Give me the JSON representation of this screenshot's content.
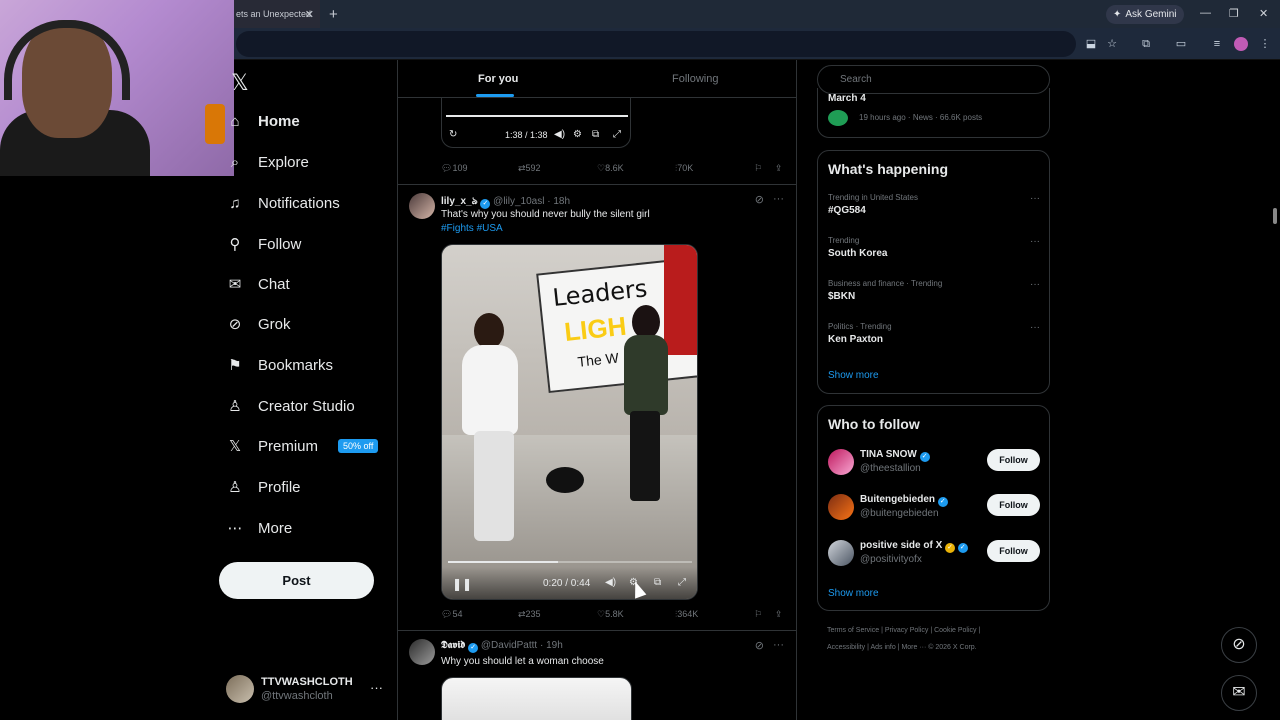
{
  "browser": {
    "tab_title": "ets an Unexpected",
    "new_tab": "+",
    "gemini_label": "Ask Gemini",
    "window_controls": [
      "—",
      "❐",
      "✕"
    ]
  },
  "sidebar": {
    "logo": "𝕏",
    "items": [
      {
        "label": "Home",
        "icon": "home-icon",
        "glyph": "⌂"
      },
      {
        "label": "Explore",
        "icon": "search-icon",
        "glyph": "⌕"
      },
      {
        "label": "Notifications",
        "icon": "bell-icon",
        "glyph": "🔔"
      },
      {
        "label": "Follow",
        "icon": "person-add-icon",
        "glyph": "👤"
      },
      {
        "label": "Chat",
        "icon": "mail-icon",
        "glyph": "✉"
      },
      {
        "label": "Grok",
        "icon": "grok-icon",
        "glyph": "⊘"
      },
      {
        "label": "Bookmarks",
        "icon": "bookmark-icon",
        "glyph": "🔖"
      },
      {
        "label": "Creator Studio",
        "icon": "creator-icon",
        "glyph": "♙"
      },
      {
        "label": "Premium",
        "icon": "x-premium-icon",
        "glyph": "𝕏"
      },
      {
        "label": "Profile",
        "icon": "profile-icon",
        "glyph": "👤"
      },
      {
        "label": "More",
        "icon": "more-circle-icon",
        "glyph": "⋯"
      }
    ],
    "premium_badge": "50% off",
    "post_label": "Post",
    "account": {
      "name": "TTVWASHCLOTH",
      "handle": "@ttvwashcloth",
      "menu": "···"
    }
  },
  "timeline": {
    "tabs": [
      "For you",
      "Following"
    ],
    "prev_video": {
      "time": "1:38 / 1:38"
    },
    "prev_actions": {
      "replies": "109",
      "reposts": "592",
      "likes": "8.6K",
      "views": "70K"
    },
    "tweet1": {
      "name": "lily_x_ঌ",
      "handle": "@lily_10asl",
      "time": "· 18h",
      "text": "That's why you should never bully the silent girl",
      "tags": "#Fights #USA",
      "video_time": "0:20 / 0:44",
      "video_progress": 0.45,
      "sign_line1": "Leaders",
      "sign_line2": "LIGH",
      "sign_line3": "The W",
      "actions": {
        "replies": "54",
        "reposts": "235",
        "likes": "5.8K",
        "views": "364K"
      }
    },
    "tweet2": {
      "name": "𝕯𝖆𝖛𝖎𝖉",
      "handle": "@DavidPattt",
      "time": "· 19h",
      "text": "Why you should let a woman choose"
    }
  },
  "right": {
    "search_placeholder": "Search",
    "live": {
      "title": "March 4",
      "meta": "19 hours ago · News · 66.6K posts"
    },
    "whats_happening": {
      "title": "What's happening",
      "trends": [
        {
          "context": "Trending in United States",
          "name": "#QG584"
        },
        {
          "context": "Trending",
          "name": "South Korea"
        },
        {
          "context": "Business and finance · Trending",
          "name": "$BKN"
        },
        {
          "context": "Politics · Trending",
          "name": "Ken Paxton"
        }
      ],
      "show_more": "Show more"
    },
    "who_to_follow": {
      "title": "Who to follow",
      "accounts": [
        {
          "name": "TINA SNOW",
          "handle": "@theestallion",
          "button": "Follow"
        },
        {
          "name": "Buitengebieden",
          "handle": "@buitengebieden",
          "button": "Follow"
        },
        {
          "name": "positive side of X",
          "handle": "@positivityofx",
          "button": "Follow"
        }
      ],
      "show_more": "Show more"
    },
    "footer_line1": "Terms of Service  |  Privacy Policy  |  Cookie Policy  |",
    "footer_line2": "Accessibility  |  Ads info  |  More ···  © 2026 X Corp."
  },
  "colors": {
    "accent": "#1d9bf0",
    "background": "#000000",
    "border": "#2f3336",
    "muted": "#71767b"
  }
}
